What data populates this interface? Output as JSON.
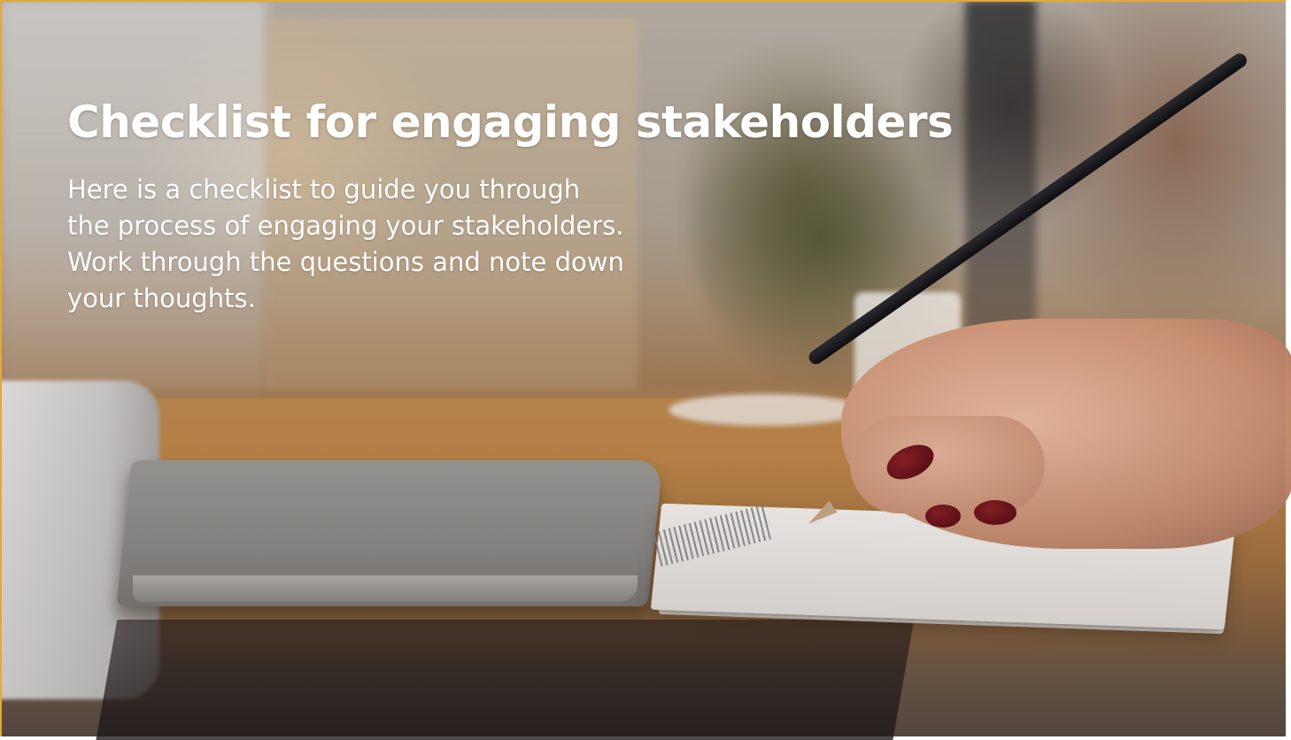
{
  "slide": {
    "title": "Checklist for engaging stakeholders",
    "intro_lines": [
      "Here is a checklist to guide you through",
      "the process of engaging your stakeholders.",
      "Work through the questions and note down",
      "your thoughts."
    ],
    "background": {
      "image": "photo-hand-writing-in-notebook",
      "accent_color": "#e2a93a",
      "text_color": "#ffffff"
    }
  }
}
